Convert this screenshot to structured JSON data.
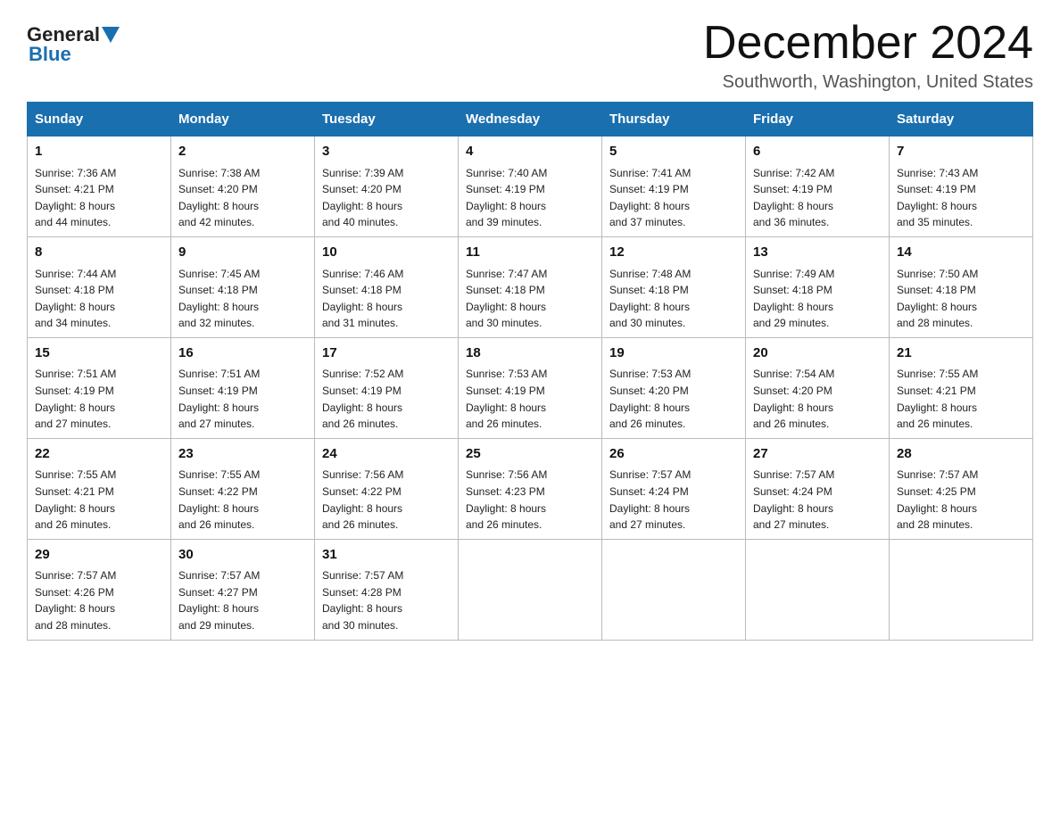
{
  "logo": {
    "general": "General",
    "blue": "Blue"
  },
  "header": {
    "month_year": "December 2024",
    "location": "Southworth, Washington, United States"
  },
  "days_of_week": [
    "Sunday",
    "Monday",
    "Tuesday",
    "Wednesday",
    "Thursday",
    "Friday",
    "Saturday"
  ],
  "weeks": [
    [
      {
        "day": "1",
        "sunrise": "7:36 AM",
        "sunset": "4:21 PM",
        "daylight": "8 hours and 44 minutes."
      },
      {
        "day": "2",
        "sunrise": "7:38 AM",
        "sunset": "4:20 PM",
        "daylight": "8 hours and 42 minutes."
      },
      {
        "day": "3",
        "sunrise": "7:39 AM",
        "sunset": "4:20 PM",
        "daylight": "8 hours and 40 minutes."
      },
      {
        "day": "4",
        "sunrise": "7:40 AM",
        "sunset": "4:19 PM",
        "daylight": "8 hours and 39 minutes."
      },
      {
        "day": "5",
        "sunrise": "7:41 AM",
        "sunset": "4:19 PM",
        "daylight": "8 hours and 37 minutes."
      },
      {
        "day": "6",
        "sunrise": "7:42 AM",
        "sunset": "4:19 PM",
        "daylight": "8 hours and 36 minutes."
      },
      {
        "day": "7",
        "sunrise": "7:43 AM",
        "sunset": "4:19 PM",
        "daylight": "8 hours and 35 minutes."
      }
    ],
    [
      {
        "day": "8",
        "sunrise": "7:44 AM",
        "sunset": "4:18 PM",
        "daylight": "8 hours and 34 minutes."
      },
      {
        "day": "9",
        "sunrise": "7:45 AM",
        "sunset": "4:18 PM",
        "daylight": "8 hours and 32 minutes."
      },
      {
        "day": "10",
        "sunrise": "7:46 AM",
        "sunset": "4:18 PM",
        "daylight": "8 hours and 31 minutes."
      },
      {
        "day": "11",
        "sunrise": "7:47 AM",
        "sunset": "4:18 PM",
        "daylight": "8 hours and 30 minutes."
      },
      {
        "day": "12",
        "sunrise": "7:48 AM",
        "sunset": "4:18 PM",
        "daylight": "8 hours and 30 minutes."
      },
      {
        "day": "13",
        "sunrise": "7:49 AM",
        "sunset": "4:18 PM",
        "daylight": "8 hours and 29 minutes."
      },
      {
        "day": "14",
        "sunrise": "7:50 AM",
        "sunset": "4:18 PM",
        "daylight": "8 hours and 28 minutes."
      }
    ],
    [
      {
        "day": "15",
        "sunrise": "7:51 AM",
        "sunset": "4:19 PM",
        "daylight": "8 hours and 27 minutes."
      },
      {
        "day": "16",
        "sunrise": "7:51 AM",
        "sunset": "4:19 PM",
        "daylight": "8 hours and 27 minutes."
      },
      {
        "day": "17",
        "sunrise": "7:52 AM",
        "sunset": "4:19 PM",
        "daylight": "8 hours and 26 minutes."
      },
      {
        "day": "18",
        "sunrise": "7:53 AM",
        "sunset": "4:19 PM",
        "daylight": "8 hours and 26 minutes."
      },
      {
        "day": "19",
        "sunrise": "7:53 AM",
        "sunset": "4:20 PM",
        "daylight": "8 hours and 26 minutes."
      },
      {
        "day": "20",
        "sunrise": "7:54 AM",
        "sunset": "4:20 PM",
        "daylight": "8 hours and 26 minutes."
      },
      {
        "day": "21",
        "sunrise": "7:55 AM",
        "sunset": "4:21 PM",
        "daylight": "8 hours and 26 minutes."
      }
    ],
    [
      {
        "day": "22",
        "sunrise": "7:55 AM",
        "sunset": "4:21 PM",
        "daylight": "8 hours and 26 minutes."
      },
      {
        "day": "23",
        "sunrise": "7:55 AM",
        "sunset": "4:22 PM",
        "daylight": "8 hours and 26 minutes."
      },
      {
        "day": "24",
        "sunrise": "7:56 AM",
        "sunset": "4:22 PM",
        "daylight": "8 hours and 26 minutes."
      },
      {
        "day": "25",
        "sunrise": "7:56 AM",
        "sunset": "4:23 PM",
        "daylight": "8 hours and 26 minutes."
      },
      {
        "day": "26",
        "sunrise": "7:57 AM",
        "sunset": "4:24 PM",
        "daylight": "8 hours and 27 minutes."
      },
      {
        "day": "27",
        "sunrise": "7:57 AM",
        "sunset": "4:24 PM",
        "daylight": "8 hours and 27 minutes."
      },
      {
        "day": "28",
        "sunrise": "7:57 AM",
        "sunset": "4:25 PM",
        "daylight": "8 hours and 28 minutes."
      }
    ],
    [
      {
        "day": "29",
        "sunrise": "7:57 AM",
        "sunset": "4:26 PM",
        "daylight": "8 hours and 28 minutes."
      },
      {
        "day": "30",
        "sunrise": "7:57 AM",
        "sunset": "4:27 PM",
        "daylight": "8 hours and 29 minutes."
      },
      {
        "day": "31",
        "sunrise": "7:57 AM",
        "sunset": "4:28 PM",
        "daylight": "8 hours and 30 minutes."
      },
      null,
      null,
      null,
      null
    ]
  ],
  "labels": {
    "sunrise": "Sunrise:",
    "sunset": "Sunset:",
    "daylight": "Daylight:"
  }
}
